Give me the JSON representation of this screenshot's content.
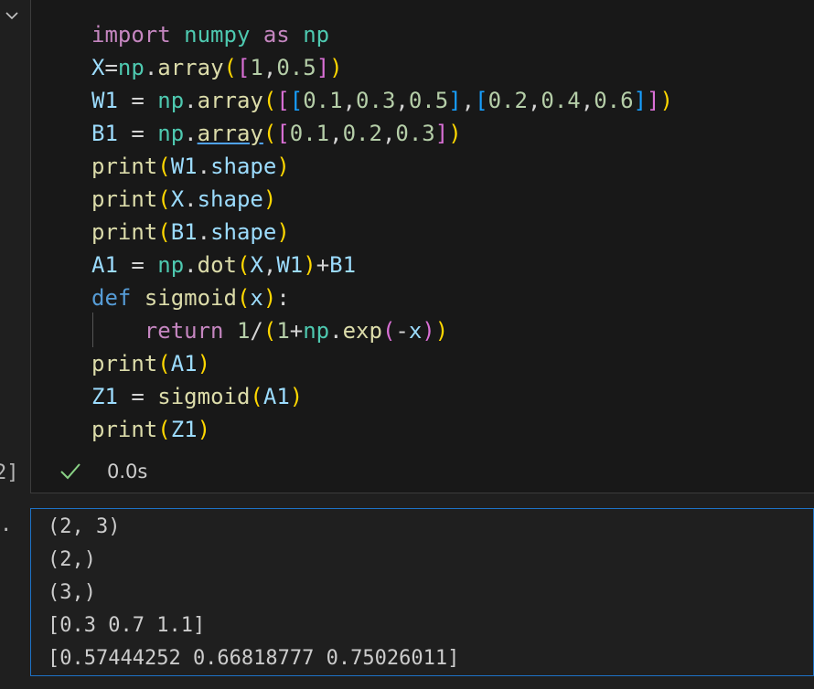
{
  "cell": {
    "execution_count": "2]",
    "output_marker": ".",
    "status": {
      "icon": "check-icon",
      "duration": "0.0s",
      "success_color": "#89d185"
    },
    "code_lines": [
      "import numpy as np",
      "X=np.array([1,0.5])",
      "W1 = np.array([[0.1,0.3,0.5],[0.2,0.4,0.6]])",
      "B1 = np.array([0.1,0.2,0.3])",
      "print(W1.shape)",
      "print(X.shape)",
      "print(B1.shape)",
      "A1 = np.dot(X,W1)+B1",
      "def sigmoid(x):",
      "    return 1/(1+np.exp(-x))",
      "print(A1)",
      "Z1 = sigmoid(A1)",
      "print(Z1)"
    ],
    "output_lines": [
      "(2, 3)",
      "(2,)",
      "(3,)",
      "[0.3 0.7 1.1]",
      "[0.57444252 0.66818777 0.75026011]"
    ]
  },
  "colors": {
    "background": "#1f1f1f",
    "editor_background": "#181818",
    "focus_border": "#1e72c6",
    "keyword": "#c586c0",
    "def_keyword": "#569cd6",
    "module": "#4ec9b0",
    "variable": "#9cdcfe",
    "function": "#dcdcaa",
    "number": "#b5cea8"
  }
}
